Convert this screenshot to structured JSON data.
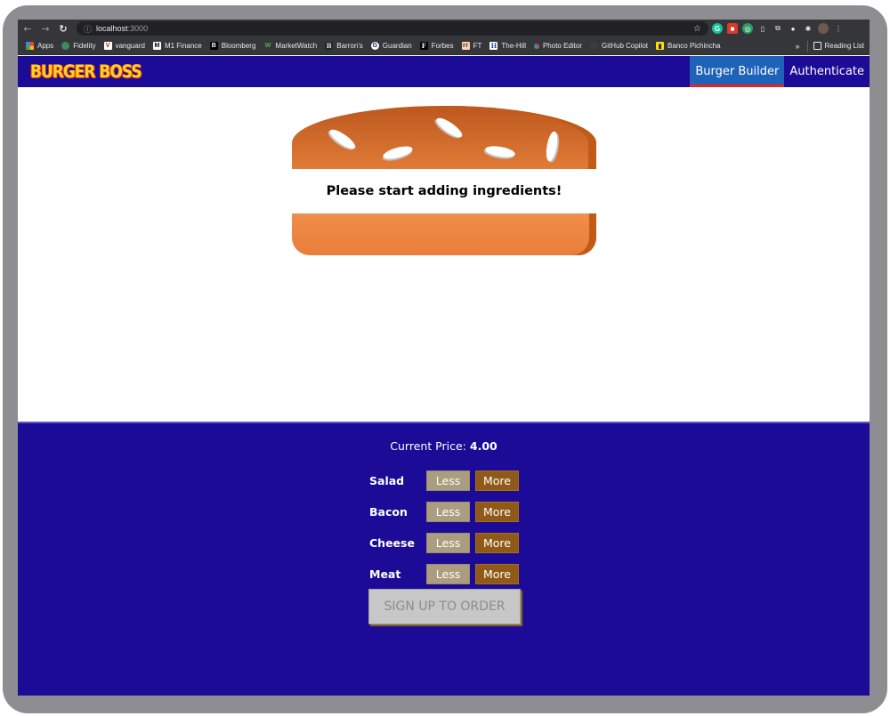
{
  "browser": {
    "url_host": "localhost",
    "url_port": ":3000",
    "bookmarks": [
      {
        "label": "Apps",
        "icon": "apps-grid-icon"
      },
      {
        "label": "Fidelity",
        "icon": "fidelity-icon"
      },
      {
        "label": "vanguard",
        "icon": "vanguard-icon"
      },
      {
        "label": "M1 Finance",
        "icon": "m1-finance-icon"
      },
      {
        "label": "Bloomberg",
        "icon": "bloomberg-icon"
      },
      {
        "label": "MarketWatch",
        "icon": "marketwatch-icon"
      },
      {
        "label": "Barron's",
        "icon": "barrons-icon"
      },
      {
        "label": "Guardian",
        "icon": "guardian-icon"
      },
      {
        "label": "Forbes",
        "icon": "forbes-icon"
      },
      {
        "label": "FT",
        "icon": "ft-icon"
      },
      {
        "label": "The-Hill",
        "icon": "the-hill-icon"
      },
      {
        "label": "Photo Editor",
        "icon": "photo-editor-icon"
      },
      {
        "label": "GitHub Copilot",
        "icon": "github-icon"
      },
      {
        "label": "Banco Pichincha",
        "icon": "banco-pichincha-icon"
      }
    ],
    "bookmarks_more": "»",
    "reading_list": "Reading List"
  },
  "header": {
    "logo": "BURGER BOSS",
    "nav": [
      {
        "label": "Burger Builder",
        "active": true
      },
      {
        "label": "Authenticate",
        "active": false
      }
    ]
  },
  "burger": {
    "empty_message": "Please start adding ingredients!"
  },
  "controls": {
    "price_label": "Current Price:",
    "price_value": "4.00",
    "ingredients": [
      {
        "label": "Salad",
        "less": "Less",
        "more": "More"
      },
      {
        "label": "Bacon",
        "less": "Less",
        "more": "More"
      },
      {
        "label": "Cheese",
        "less": "Less",
        "more": "More"
      },
      {
        "label": "Meat",
        "less": "Less",
        "more": "More"
      }
    ],
    "order_button": "SIGN UP TO ORDER"
  },
  "colors": {
    "header_bg": "#1c0b96",
    "active_nav_bg": "#1e62b9",
    "active_nav_underline": "#e0262c",
    "less_button": "#ab9d80",
    "more_button": "#8f5917",
    "bread": "#e07b37"
  }
}
